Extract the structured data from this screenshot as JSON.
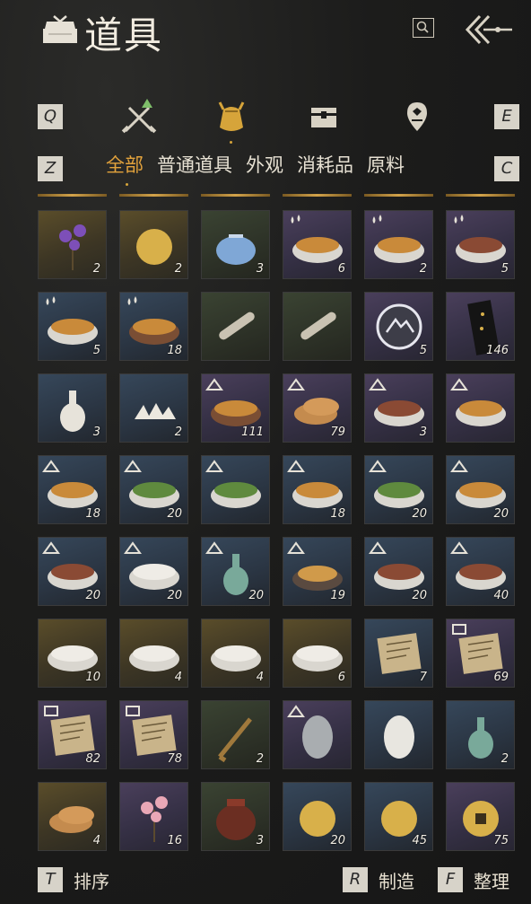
{
  "header": {
    "title": "道具",
    "logo_icon": "hat-emblem-icon",
    "search_icon": "search-icon",
    "back_icon": "back-arrows-icon"
  },
  "category_tabs": {
    "prev_key": "Q",
    "next_key": "E",
    "tabs": [
      {
        "icon": "crossed-swords-icon",
        "active": false
      },
      {
        "icon": "pouch-icon",
        "active": true
      },
      {
        "icon": "chest-icon",
        "active": false
      },
      {
        "icon": "map-pin-icon",
        "active": false
      }
    ]
  },
  "sub_tabs": {
    "prev_key": "Z",
    "next_key": "C",
    "items": [
      "全部",
      "普通道具",
      "外观",
      "消耗品",
      "原料"
    ],
    "active_index": 0
  },
  "items": [
    {
      "qty": "2",
      "rarity": "gold",
      "icon": "purple-flower-icon",
      "badge": ""
    },
    {
      "qty": "2",
      "rarity": "gold",
      "icon": "orb-on-stand-icon",
      "badge": ""
    },
    {
      "qty": "3",
      "rarity": "green",
      "icon": "blue-pouch-icon",
      "badge": ""
    },
    {
      "qty": "6",
      "rarity": "purple",
      "icon": "fish-soup-bowl-icon",
      "badge": "drops-icon"
    },
    {
      "qty": "2",
      "rarity": "purple",
      "icon": "egg-soup-bowl-icon",
      "badge": "drops-icon"
    },
    {
      "qty": "5",
      "rarity": "purple",
      "icon": "meat-bowl-icon",
      "badge": "drops-icon"
    },
    {
      "qty": "5",
      "rarity": "blue",
      "icon": "egg-plate-icon",
      "badge": "drops-icon"
    },
    {
      "qty": "18",
      "rarity": "blue",
      "icon": "clay-pot-stew-icon",
      "badge": "drops-icon"
    },
    {
      "qty": "",
      "rarity": "green",
      "icon": "scroll-icon",
      "badge": ""
    },
    {
      "qty": "",
      "rarity": "green",
      "icon": "scroll-icon",
      "badge": ""
    },
    {
      "qty": "5",
      "rarity": "purple",
      "icon": "mountain-token-icon",
      "badge": ""
    },
    {
      "qty": "146",
      "rarity": "purple",
      "icon": "black-talisman-icon",
      "badge": ""
    },
    {
      "qty": "3",
      "rarity": "blue",
      "icon": "white-vase-icon",
      "badge": ""
    },
    {
      "qty": "2",
      "rarity": "blue",
      "icon": "rice-cakes-icon",
      "badge": ""
    },
    {
      "qty": "111",
      "rarity": "purple",
      "icon": "stew-pot-icon",
      "badge": "mountain-icon"
    },
    {
      "qty": "79",
      "rarity": "purple",
      "icon": "buns-basket-icon",
      "badge": "mountain-icon"
    },
    {
      "qty": "3",
      "rarity": "purple",
      "icon": "sausage-plate-icon",
      "badge": "mountain-icon"
    },
    {
      "qty": "",
      "rarity": "purple",
      "icon": "noodle-bowl-icon",
      "badge": "mountain-icon"
    },
    {
      "qty": "18",
      "rarity": "blue",
      "icon": "spicy-bowl-icon",
      "badge": "mountain-icon"
    },
    {
      "qty": "20",
      "rarity": "blue",
      "icon": "greens-bowl-icon",
      "badge": "mountain-icon"
    },
    {
      "qty": "",
      "rarity": "blue",
      "icon": "greens-plate-icon",
      "badge": "mountain-icon"
    },
    {
      "qty": "18",
      "rarity": "blue",
      "icon": "soup-bowl-icon",
      "badge": "mountain-icon"
    },
    {
      "qty": "20",
      "rarity": "blue",
      "icon": "spinach-plate-icon",
      "badge": "mountain-icon"
    },
    {
      "qty": "20",
      "rarity": "blue",
      "icon": "broth-bowl-icon",
      "badge": "mountain-icon"
    },
    {
      "qty": "20",
      "rarity": "blue",
      "icon": "sliced-meat-plate-icon",
      "badge": "mountain-icon"
    },
    {
      "qty": "20",
      "rarity": "blue",
      "icon": "congee-bowl-icon",
      "badge": "mountain-icon"
    },
    {
      "qty": "20",
      "rarity": "blue",
      "icon": "celadon-vase-icon",
      "badge": "mountain-icon"
    },
    {
      "qty": "19",
      "rarity": "blue",
      "icon": "fried-noodles-icon",
      "badge": "mountain-icon"
    },
    {
      "qty": "20",
      "rarity": "blue",
      "icon": "pork-belly-plate-icon",
      "badge": "mountain-icon"
    },
    {
      "qty": "40",
      "rarity": "blue",
      "icon": "meatballs-plate-icon",
      "badge": "mountain-icon"
    },
    {
      "qty": "10",
      "rarity": "gold",
      "icon": "floral-bowl-icon",
      "badge": ""
    },
    {
      "qty": "4",
      "rarity": "gold",
      "icon": "rooster-bowl-icon",
      "badge": ""
    },
    {
      "qty": "4",
      "rarity": "gold",
      "icon": "porcelain-bowl-icon",
      "badge": ""
    },
    {
      "qty": "6",
      "rarity": "gold",
      "icon": "lidded-bowl-icon",
      "badge": ""
    },
    {
      "qty": "7",
      "rarity": "blue",
      "icon": "paper-sheet-icon",
      "badge": ""
    },
    {
      "qty": "69",
      "rarity": "purple",
      "icon": "recipe-letter-icon",
      "badge": "book-icon"
    },
    {
      "qty": "82",
      "rarity": "purple",
      "icon": "recipe-letter-icon",
      "badge": "book-icon"
    },
    {
      "qty": "78",
      "rarity": "purple",
      "icon": "recipe-letter-icon",
      "badge": "book-icon"
    },
    {
      "qty": "2",
      "rarity": "green",
      "icon": "wooden-frame-icon",
      "badge": ""
    },
    {
      "qty": "",
      "rarity": "purple",
      "icon": "grey-egg-icon",
      "badge": "mountain-icon"
    },
    {
      "qty": "",
      "rarity": "blue",
      "icon": "white-egg-icon",
      "badge": ""
    },
    {
      "qty": "2",
      "rarity": "blue",
      "icon": "green-teapot-icon",
      "badge": ""
    },
    {
      "qty": "4",
      "rarity": "gold",
      "icon": "flatbread-icon",
      "badge": ""
    },
    {
      "qty": "16",
      "rarity": "purple",
      "icon": "plum-blossom-icon",
      "badge": ""
    },
    {
      "qty": "3",
      "rarity": "green",
      "icon": "wine-jar-icon",
      "badge": ""
    },
    {
      "qty": "20",
      "rarity": "blue",
      "icon": "bronze-bell-icon",
      "badge": ""
    },
    {
      "qty": "45",
      "rarity": "blue",
      "icon": "gold-ingot-icon",
      "badge": ""
    },
    {
      "qty": "75",
      "rarity": "purple",
      "icon": "square-hole-coin-icon",
      "badge": ""
    }
  ],
  "footer": {
    "sort": {
      "key": "T",
      "label": "排序"
    },
    "craft": {
      "key": "R",
      "label": "制造"
    },
    "organize": {
      "key": "F",
      "label": "整理"
    }
  },
  "colors": {
    "accent": "#e2a23c",
    "gold_line": "#d3a34a",
    "key_bg": "#d7d3c9"
  }
}
